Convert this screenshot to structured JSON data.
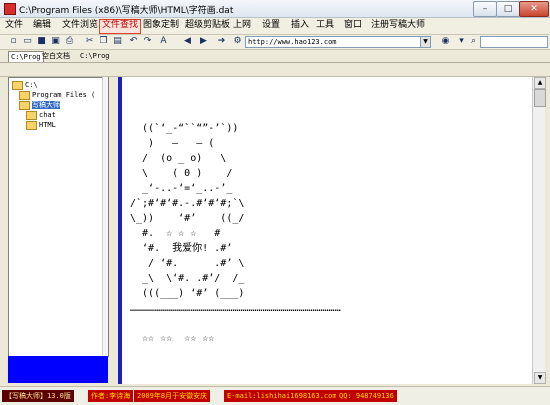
{
  "window": {
    "title": "C:\\Program Files (x86)\\写稿大师\\HTML\\字符画.dat",
    "min": "–",
    "max": "□",
    "close": "✕"
  },
  "menu": [
    "文件",
    "编辑",
    "文件浏览",
    "文件查找",
    "图象定制",
    "超级剪贴板",
    "上网",
    "设置",
    "插入",
    "工具",
    "窗口",
    "注册写稿大师"
  ],
  "menu_active": 3,
  "toolbar": {
    "address": "http://www.hao123.com",
    "icons": [
      "new-icon",
      "open-icon",
      "save-icon",
      "saveall-icon",
      "print-icon",
      "cut-icon",
      "copy-icon",
      "paste-icon",
      "undo-icon",
      "redo-icon",
      "format-icon",
      "back-icon",
      "forward-icon",
      "go-icon",
      "tools-icon",
      "globe-icon",
      "settings-icon",
      "search-icon"
    ]
  },
  "tabs": [
    "C:\\Prog",
    "空白文档",
    "C:\\Prog"
  ],
  "tree": [
    {
      "label": "C:\\",
      "depth": 0
    },
    {
      "label": "Program Files (",
      "depth": 1
    },
    {
      "label": "写稿大师",
      "depth": 1,
      "selected": true
    },
    {
      "label": "chat",
      "depth": 2
    },
    {
      "label": "HTML",
      "depth": 2
    }
  ],
  "document": {
    "art": [
      "",
      "  ((`‘_-“``“”-’`))",
      "   )   –   – (",
      "  /  (o _ o)   \\",
      "  \\    ( 0 )    /",
      "  _‘-..-‘=‘_..-’_",
      "/`;#‘#‘#.-.#‘#‘#;`\\",
      "\\_))    ‘#’    ((_/",
      "  #.  ☆ ☆ ☆   #",
      "  ‘#.  我爱你! .#’",
      "   / ‘#.      .#’ \\",
      "  _\\  \\‘#. .#’/  /_",
      "  (((___) ‘#’ (___)",
      "……………………………………………………………………………………………",
      "",
      "  ☆☆ ☆☆  ☆☆ ☆☆"
    ]
  },
  "statusbar": [
    "【写稿大师】13.0版",
    "作者:李诗海",
    "2009年8月于安徽安庆",
    "E-mail:lishihai1698163.com",
    "QQ: 948749136"
  ]
}
